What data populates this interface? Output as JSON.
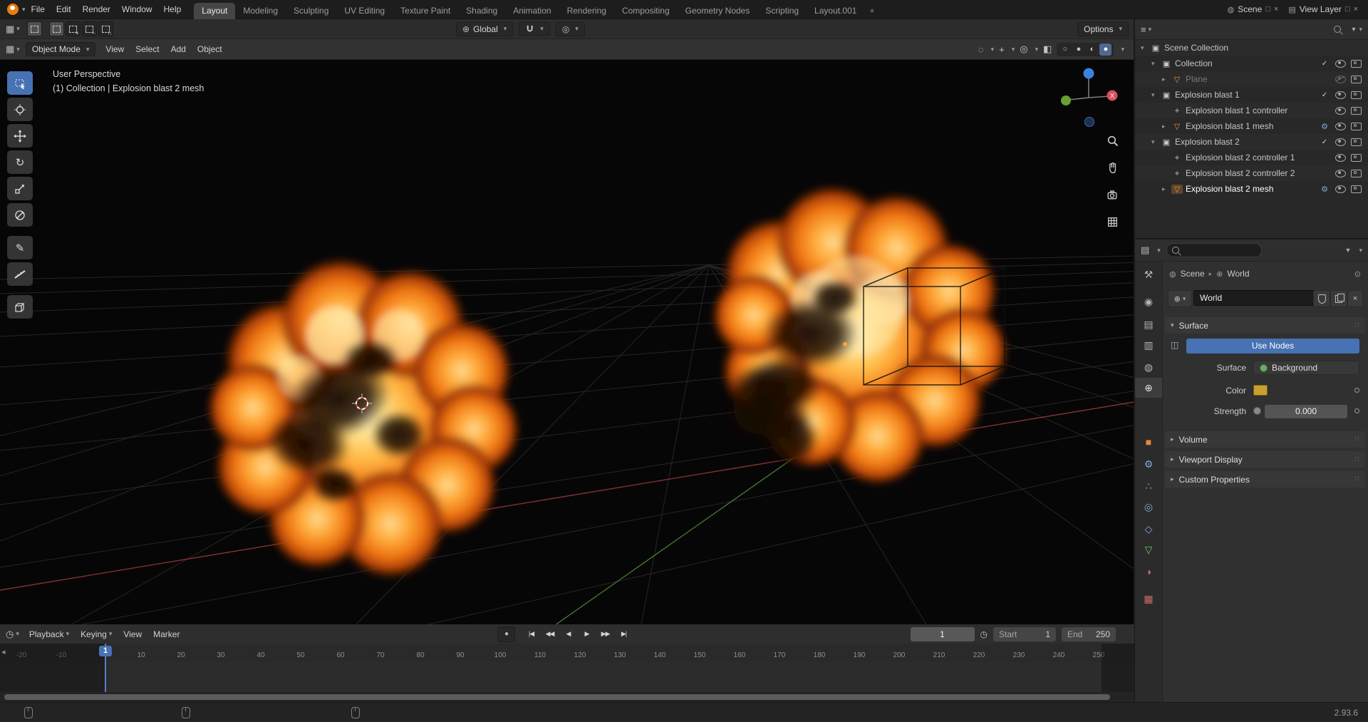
{
  "colors": {
    "accent_blue": "#4772b3",
    "active_tab_bg": "#454545",
    "axis_x_red": "#8a3535",
    "axis_y_green": "#4a7a35",
    "gizmo_x": "#d94f5c",
    "gizmo_y": "#66a031",
    "gizmo_z": "#3b82e0",
    "explosion_core": "#ffe9b0",
    "explosion_mid": "#f57f1b",
    "swatch_yellow": "#c9a12f"
  },
  "topbar": {
    "menus": [
      "File",
      "Edit",
      "Render",
      "Window",
      "Help"
    ],
    "tabs": [
      {
        "label": "Layout",
        "active": true
      },
      {
        "label": "Modeling"
      },
      {
        "label": "Sculpting"
      },
      {
        "label": "UV Editing"
      },
      {
        "label": "Texture Paint"
      },
      {
        "label": "Shading"
      },
      {
        "label": "Animation"
      },
      {
        "label": "Rendering"
      },
      {
        "label": "Compositing"
      },
      {
        "label": "Geometry Nodes"
      },
      {
        "label": "Scripting"
      },
      {
        "label": "Layout.001"
      }
    ],
    "add_tab": "+",
    "scene_label": "Scene",
    "view_layer_label": "View Layer"
  },
  "tool_header": {
    "orientation_label": "Global",
    "options_label": "Options"
  },
  "view_header": {
    "mode_label": "Object Mode",
    "menus": [
      "View",
      "Select",
      "Add",
      "Object"
    ]
  },
  "viewport": {
    "overlay_line1": "User Perspective",
    "overlay_line2": "(1) Collection | Explosion blast 2 mesh",
    "gizmo_x_label": "X"
  },
  "outliner": {
    "rows": [
      {
        "label": "Scene Collection",
        "icon": "collection",
        "indent": 0,
        "arrow": "▾",
        "controls": []
      },
      {
        "label": "Collection",
        "icon": "collection",
        "indent": 1,
        "arrow": "▾",
        "controls": [
          "check",
          "eye",
          "camera"
        ]
      },
      {
        "label": "Plane",
        "icon": "mesh",
        "indent": 2,
        "arrow": "▸",
        "dimmed": true,
        "controls": [
          "eye-off",
          "camera"
        ]
      },
      {
        "label": "Explosion blast 1",
        "icon": "collection",
        "indent": 1,
        "arrow": "▾",
        "controls": [
          "check",
          "eye",
          "camera"
        ]
      },
      {
        "label": "Explosion blast 1 controller",
        "icon": "empty",
        "indent": 2,
        "arrow": "",
        "controls": [
          "eye",
          "camera"
        ]
      },
      {
        "label": "Explosion blast 1 mesh",
        "icon": "mesh",
        "indent": 2,
        "arrow": "▸",
        "modifier": true,
        "controls": [
          "eye",
          "camera"
        ]
      },
      {
        "label": "Explosion blast 2",
        "icon": "collection",
        "indent": 1,
        "arrow": "▾",
        "controls": [
          "check",
          "eye",
          "camera"
        ]
      },
      {
        "label": "Explosion blast 2 controller 1",
        "icon": "empty",
        "indent": 2,
        "arrow": "",
        "controls": [
          "eye",
          "camera"
        ]
      },
      {
        "label": "Explosion blast 2 controller 2",
        "icon": "empty",
        "indent": 2,
        "arrow": "",
        "controls": [
          "eye",
          "camera"
        ]
      },
      {
        "label": "Explosion blast 2 mesh",
        "icon": "mesh",
        "indent": 2,
        "arrow": "▸",
        "active": true,
        "modifier": true,
        "controls": [
          "eye",
          "camera"
        ]
      }
    ]
  },
  "properties": {
    "tabs": [
      {
        "name": "tool",
        "glyph": "⚒",
        "color": "#b3b3b3"
      },
      {
        "name": "render",
        "glyph": "◉",
        "color": "#b3b3b3"
      },
      {
        "name": "output",
        "glyph": "▤",
        "color": "#b3b3b3"
      },
      {
        "name": "view-layer",
        "glyph": "▥",
        "color": "#b3b3b3"
      },
      {
        "name": "scene",
        "glyph": "◍",
        "color": "#b3b3b3"
      },
      {
        "name": "world",
        "glyph": "⊕",
        "color": "#e0e0e0",
        "active": true
      },
      {
        "name": "object",
        "glyph": "■",
        "color": "#e8883c"
      },
      {
        "name": "modifiers",
        "glyph": "⚙",
        "color": "#85a8d0"
      },
      {
        "name": "particles",
        "glyph": "∴",
        "color": "#85a8d0"
      },
      {
        "name": "physics",
        "glyph": "◎",
        "color": "#85a8d0"
      },
      {
        "name": "constraints",
        "glyph": "◇",
        "color": "#85a8d0"
      },
      {
        "name": "data",
        "glyph": "▽",
        "color": "#6fbf6f"
      },
      {
        "name": "material",
        "glyph": "◑",
        "color": "#d06a6a"
      },
      {
        "name": "texture",
        "glyph": "▦",
        "color": "#d06a6a"
      }
    ],
    "breadcrumb_scene": "Scene",
    "breadcrumb_world": "World",
    "world_name": "World",
    "surface_panel": "Surface",
    "use_nodes": "Use Nodes",
    "surface_label": "Surface",
    "surface_value": "Background",
    "color_label": "Color",
    "strength_label": "Strength",
    "strength_value": "0.000",
    "volume_panel": "Volume",
    "viewport_display_panel": "Viewport Display",
    "custom_props_panel": "Custom Properties"
  },
  "timeline": {
    "menus": [
      {
        "label": "Playback",
        "chev": true
      },
      {
        "label": "Keying",
        "chev": true
      },
      {
        "label": "View"
      },
      {
        "label": "Marker"
      }
    ],
    "playback": [
      {
        "name": "auto-key",
        "glyph": "●"
      },
      {
        "name": "jump-start",
        "glyph": "|◀"
      },
      {
        "name": "prev-keyframe",
        "glyph": "◀◀"
      },
      {
        "name": "play-reverse",
        "glyph": "◀"
      },
      {
        "name": "play",
        "glyph": "▶"
      },
      {
        "name": "next-keyframe",
        "glyph": "▶▶"
      },
      {
        "name": "jump-end",
        "glyph": "▶|"
      }
    ],
    "current_frame": "1",
    "start_label": "Start",
    "start_value": "1",
    "end_label": "End",
    "end_value": "250",
    "ruler_numbers": [
      -20,
      -10,
      10,
      20,
      30,
      40,
      50,
      60,
      70,
      80,
      90,
      100,
      110,
      120,
      130,
      140,
      150,
      160,
      170,
      180,
      190,
      200,
      210,
      220,
      230,
      240,
      250
    ],
    "playhead": {
      "frame": 1,
      "label": "1"
    }
  },
  "statusbar": {
    "version": "2.93.6"
  }
}
